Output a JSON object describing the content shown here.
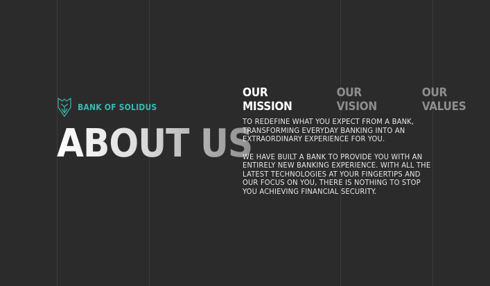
{
  "brand": {
    "name": "BANK OF SOLIDUS",
    "logo_icon": "lion-shield-icon",
    "accent": "#3fb6b0"
  },
  "page_title": "ABOUT US",
  "tabs": [
    {
      "label": "OUR MISSION",
      "active": true
    },
    {
      "label": "OUR VISION",
      "active": false
    },
    {
      "label": "OUR VALUES",
      "active": false
    }
  ],
  "content": {
    "paragraphs": [
      "TO REDEFINE WHAT YOU EXPECT FROM A BANK, TRANSFORMING EVERYDAY BANKING INTO AN EXTRAORDINARY EXPERIENCE FOR YOU.",
      "WE HAVE BUILT A BANK TO PROVIDE YOU WITH AN ENTIRELY NEW BANKING EXPERIENCE. WITH ALL THE LATEST TECHNOLOGIES AT YOUR FINGERTIPS AND OUR FOCUS ON YOU, THERE IS NOTHING TO STOP YOU ACHIEVING FINANCIAL SECURITY."
    ]
  },
  "colors": {
    "background": "#2b2b2b",
    "gridline": "#3b3b3b",
    "active_tab": "#ffffff",
    "inactive_tab": "#8e8e8e"
  }
}
